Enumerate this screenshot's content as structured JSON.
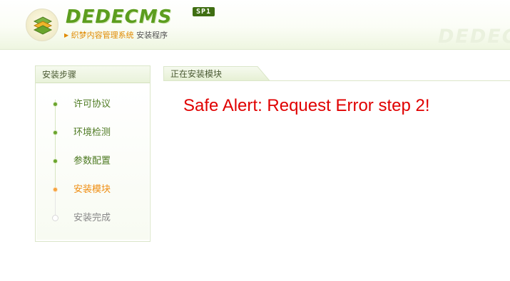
{
  "header": {
    "logo_text": "DEDECMS",
    "edition_badge": "SP1",
    "tagline_brand": "织梦内容管理系统",
    "tagline_sub": "安装程序",
    "watermark": "DEDECMS"
  },
  "sidebar": {
    "title": "安装步骤",
    "steps": [
      {
        "label": "许可协议",
        "state": "done"
      },
      {
        "label": "环境检测",
        "state": "done"
      },
      {
        "label": "参数配置",
        "state": "done"
      },
      {
        "label": "安装模块",
        "state": "active"
      },
      {
        "label": "安装完成",
        "state": "pending"
      }
    ]
  },
  "main": {
    "tab_title": "正在安装模块",
    "alert_message": "Safe Alert: Request Error step 2!"
  },
  "colors": {
    "brand_green": "#5c9d1e",
    "active_orange": "#ef8d12",
    "alert_red": "#e00000"
  }
}
